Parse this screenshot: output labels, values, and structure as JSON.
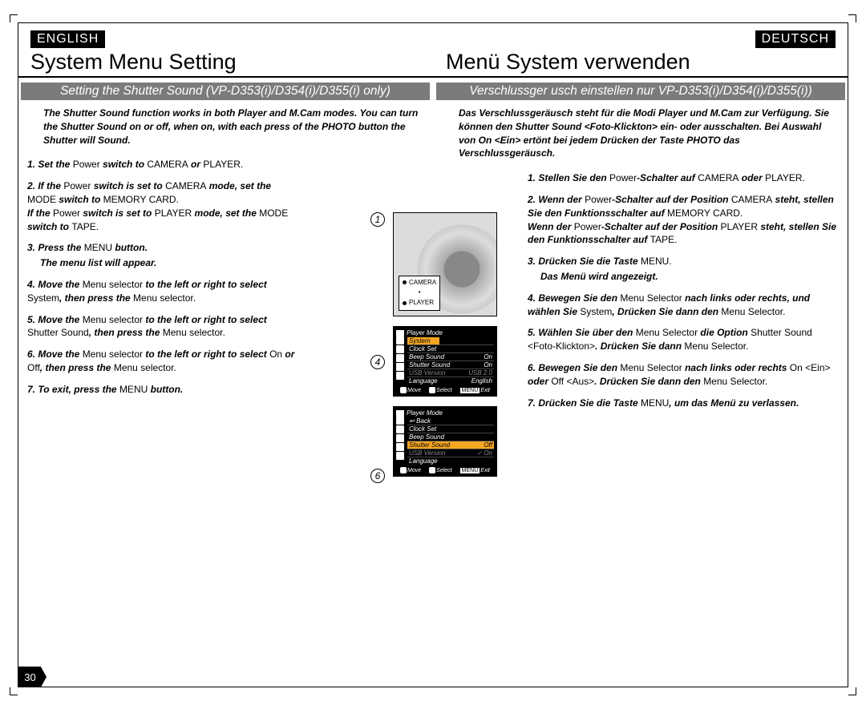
{
  "lang": {
    "left": "ENGLISH",
    "right": "DEUTSCH"
  },
  "title": {
    "left": "System Menu Setting",
    "right": "Menü System verwenden"
  },
  "subheader": {
    "left": "Setting the Shutter Sound (VP-D353(i)/D354(i)/D355(i) only)",
    "right": "Verschlussger usch einstellen nur VP-D353(i)/D354(i)/D355(i))"
  },
  "intro": {
    "left": "The Shutter Sound function works in both Player and M.Cam modes. You can turn the Shutter Sound on or off, when on, with each press of the PHOTO button the Shutter will Sound.",
    "right": "Das Verschlussgeräusch steht für die Modi Player und M.Cam zur Verfügung. Sie können den Shutter Sound <Foto-Klickton> ein- oder ausschalten. Bei Auswahl von On <Ein> ertönt bei jedem Drücken der Taste PHOTO das Verschlussgeräusch."
  },
  "steps_en": {
    "s1a": "1. Set the ",
    "s1b": "Power",
    "s1c": " switch to ",
    "s1d": "CAMERA",
    "s1e": " or ",
    "s1f": "PLAYER",
    "s1g": ".",
    "s2a": "2. If the ",
    "s2b": "Power",
    "s2c": " switch is set to ",
    "s2d": "CAMERA",
    "s2e": " mode, set the ",
    "s2f": "MODE",
    "s2g": " switch to ",
    "s2h": "MEMORY CARD",
    "s2i": ".",
    "s2j": "If the ",
    "s2k": "Power",
    "s2l": " switch is set to ",
    "s2m": "PLAYER",
    "s2n": " mode, set the ",
    "s2o": "MODE",
    "s2p": " switch to ",
    "s2q": "TAPE",
    "s2r": ".",
    "s3a": "3. Press the ",
    "s3b": "MENU",
    "s3c": " button.",
    "s3sub": "The menu list will appear.",
    "s4a": "4. Move the ",
    "s4b": "Menu selector",
    "s4c": " to the left or right to select ",
    "s4d": "System",
    "s4e": ", then press the ",
    "s4f": "Menu selector",
    "s4g": ".",
    "s5a": "5. Move the ",
    "s5b": "Menu selector",
    "s5c": " to the left or right to select ",
    "s5d": "Shutter Sound",
    "s5e": ", then press the ",
    "s5f": "Menu selector",
    "s5g": ".",
    "s6a": "6. Move the ",
    "s6b": "Menu selector",
    "s6c": " to the left or right to select ",
    "s6d": "On",
    "s6e": " or ",
    "s6f": "Off",
    "s6g": ", then press the ",
    "s6h": "Menu selector",
    "s6i": ".",
    "s7a": "7. To exit, press the ",
    "s7b": "MENU",
    "s7c": " button."
  },
  "steps_de": {
    "s1a": "1. Stellen Sie den ",
    "s1b": "Power",
    "s1c": "-Schalter auf ",
    "s1d": "CAMERA",
    "s1e": " oder ",
    "s1f": "PLAYER",
    "s1g": ".",
    "s2a": "2. Wenn der ",
    "s2b": "Power",
    "s2c": "-Schalter auf der Position ",
    "s2d": "CAMERA",
    "s2e": " steht, stellen Sie den Funktionsschalter auf ",
    "s2f": "MEMORY CARD",
    "s2g": ".",
    "s2h": "Wenn der ",
    "s2i": "Power",
    "s2j": "-Schalter auf der Position ",
    "s2k": "PLAYER",
    "s2l": " steht, stellen Sie den Funktionsschalter auf ",
    "s2m": "TAPE",
    "s2n": ".",
    "s3a": "3. Drücken Sie die Taste ",
    "s3b": "MENU",
    "s3c": ".",
    "s3sub": "Das Menü wird angezeigt.",
    "s4a": "4. Bewegen Sie den ",
    "s4b": "Menu Selector",
    "s4c": " nach links oder rechts, und wählen Sie ",
    "s4d": "System",
    "s4e": ", Drücken Sie dann den ",
    "s4f": "Menu Selector",
    "s4g": ".",
    "s5a": "5. Wählen Sie über den ",
    "s5b": "Menu Selector",
    "s5c": " die Option ",
    "s5d": "Shutter Sound <Foto-Klickton>",
    "s5e": ". Drücken Sie dann ",
    "s5f": "Menu Selector",
    "s5g": ".",
    "s6a": "6. Bewegen Sie den ",
    "s6b": "Menu Selector",
    "s6c": " nach links oder rechts ",
    "s6d": "On <Ein>",
    "s6e": " oder ",
    "s6f": "Off <Aus>",
    "s6g": ". Drücken Sie dann den ",
    "s6h": "Menu Selector",
    "s6i": ".",
    "s7a": "7. Drücken Sie die Taste ",
    "s7b": "MENU",
    "s7c": ", um das Menü zu verlassen."
  },
  "camera": {
    "label_top": "CAMERA",
    "label_bot": "PLAYER"
  },
  "screen1": {
    "mode": "Player Mode",
    "section": "System",
    "rows": [
      {
        "l": "Clock Set",
        "r": ""
      },
      {
        "l": "Beep Sound",
        "r": "On"
      },
      {
        "l": "Shutter Sound",
        "r": "On"
      },
      {
        "l": "USB Version",
        "r": "USB 2.0",
        "gray": true
      },
      {
        "l": "Language",
        "r": "English"
      }
    ],
    "footer": {
      "move": "Move",
      "select": "Select",
      "exit": "Exit",
      "menu": "MENU"
    }
  },
  "screen2": {
    "mode": "Player Mode",
    "back": "Back",
    "rows": [
      {
        "l": "Clock Set",
        "r": ""
      },
      {
        "l": "Beep Sound",
        "r": ""
      },
      {
        "l": "Shutter Sound",
        "r": "Off",
        "hl": true
      },
      {
        "l": "USB Version",
        "r": "On",
        "gray": true,
        "check": true
      },
      {
        "l": "Language",
        "r": ""
      }
    ],
    "footer": {
      "move": "Move",
      "select": "Select",
      "exit": "Exit",
      "menu": "MENU"
    }
  },
  "stepnums": {
    "n1": "1",
    "n4": "4",
    "n6": "6"
  },
  "page_number": "30"
}
